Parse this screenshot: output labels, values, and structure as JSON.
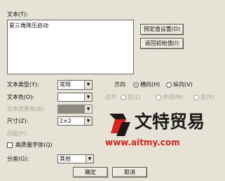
{
  "text_section": {
    "label": "文本(T):",
    "value": "星三角降压启动",
    "preset_button": "预定值设置(D)",
    "reset_button": "返回初始值(I)"
  },
  "text_type": {
    "label": "文本类型(Y):",
    "value": "常规"
  },
  "direction": {
    "label": "方向",
    "horizontal": "横向(H)",
    "vertical": "纵向(V)",
    "selected": "horizontal"
  },
  "text_color": {
    "label": "文本色(O):"
  },
  "text_bg_color": {
    "label": "文本背景色(B):"
  },
  "alignment": {
    "label": "对齐",
    "left": "左(L)",
    "center": "中间(M)",
    "right": "右(R)"
  },
  "size": {
    "label": "尺寸(Z):",
    "value": "2×2"
  },
  "spacing": {
    "label": "间距(P):"
  },
  "high_quality_font": {
    "label": "高质量字体(Q)",
    "checked": false
  },
  "category": {
    "label": "分类(G):",
    "value": "其他"
  },
  "buttons": {
    "ok": "确定",
    "cancel": "取消"
  },
  "watermark": {
    "brand": "文特贸易",
    "url": "www.aitmy.com"
  },
  "colors": {
    "dialog_bg": "#e6e2d6",
    "brand_red": "#d9231c",
    "disabled_text": "#a39f94"
  }
}
